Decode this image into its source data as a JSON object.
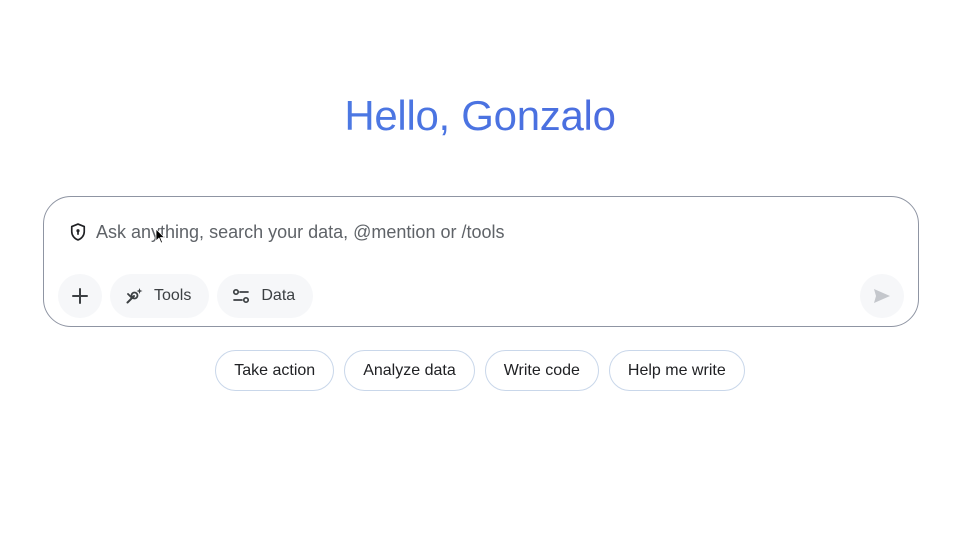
{
  "greeting": "Hello, Gonzalo",
  "prompt": {
    "placeholder": "Ask anything, search your data, @mention or /tools",
    "value": ""
  },
  "toolbar": {
    "add_icon": "plus-icon",
    "tools_label": "Tools",
    "tools_icon": "tools-sparkle-icon",
    "data_label": "Data",
    "data_icon": "sliders-icon",
    "send_icon": "send-icon"
  },
  "suggestions": [
    {
      "label": "Take action"
    },
    {
      "label": "Analyze data"
    },
    {
      "label": "Write code"
    },
    {
      "label": "Help me write"
    }
  ],
  "colors": {
    "greeting_gradient_start": "#4f86e8",
    "greeting_gradient_end": "#6a5bd6",
    "box_border": "#8f95a3",
    "chip_border": "#c9d7ea",
    "button_fill": "#f6f7f9"
  }
}
